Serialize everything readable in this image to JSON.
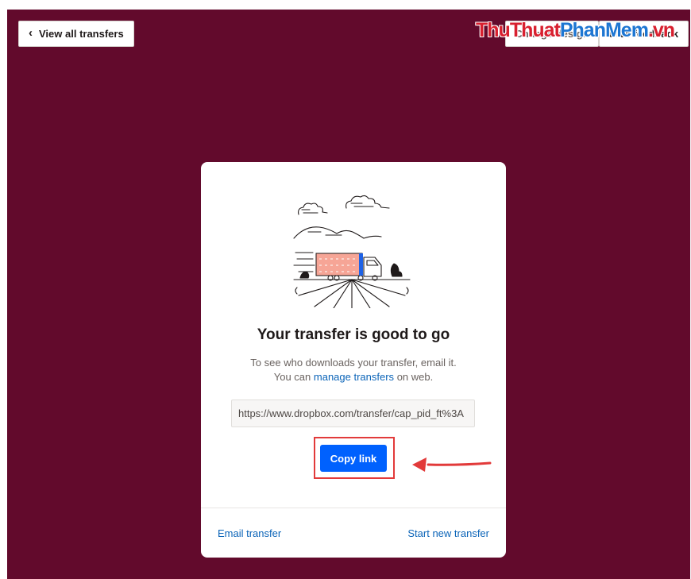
{
  "header": {
    "back_label": "View all transfers",
    "back_icon": "chevron-left-icon",
    "change_design_label": "Change design",
    "feedback_label": "Give feedback"
  },
  "watermark": {
    "part1": "ThuThuat",
    "part2": "PhanMem",
    "part3": ".vn"
  },
  "card": {
    "title": "Your transfer is good to go",
    "desc_line1": "To see who downloads your transfer, email it.",
    "desc_prefix": "You can",
    "desc_link": "manage transfers",
    "desc_suffix": "on web.",
    "url_value": "https://www.dropbox.com/transfer/cap_pid_ft%3A",
    "copy_label": "Copy link",
    "email_link": "Email transfer",
    "start_link": "Start new transfer"
  },
  "colors": {
    "background": "#620a2c",
    "accent": "#0061fe",
    "link": "#0b64b8",
    "annotation": "#e23a3a"
  }
}
